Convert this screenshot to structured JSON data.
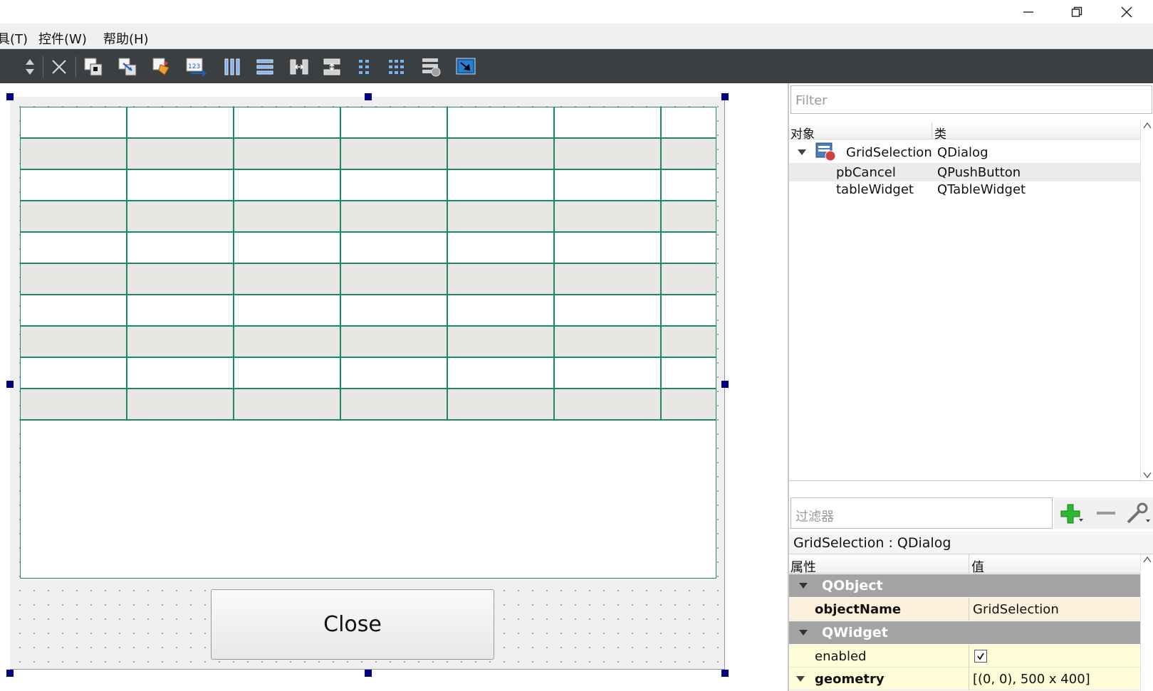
{
  "menu": {
    "items": [
      "具(T)",
      "控件(W)",
      "帮助(H)"
    ]
  },
  "canvas": {
    "close_button_label": "Close",
    "table_rows": 10,
    "table_cols": 7
  },
  "object_inspector": {
    "filter_placeholder": "Filter",
    "col_object": "对象",
    "col_class": "类",
    "rows": [
      {
        "name": "GridSelection",
        "class": "QDialog"
      },
      {
        "name": "pbCancel",
        "class": "QPushButton"
      },
      {
        "name": "tableWidget",
        "class": "QTableWidget"
      }
    ]
  },
  "property_editor": {
    "filter_placeholder": "过滤器",
    "title": "GridSelection : QDialog",
    "col_property": "属性",
    "col_value": "值",
    "group_qobject": "QObject",
    "group_qwidget": "QWidget",
    "object_name_key": "objectName",
    "object_name_value": "GridSelection",
    "enabled_key": "enabled",
    "enabled_value": true,
    "geometry_key": "geometry",
    "geometry_value": "[(0, 0), 500 x 400]"
  },
  "colors": {
    "table_grid": "#1b8a6a",
    "toolbar_bg": "#3c3f41",
    "handle": "#000080",
    "group_bg": "#a3a3a3",
    "objectname_row_bg": "#fdf1dd",
    "widget_row_bg": "#fefdd8"
  }
}
